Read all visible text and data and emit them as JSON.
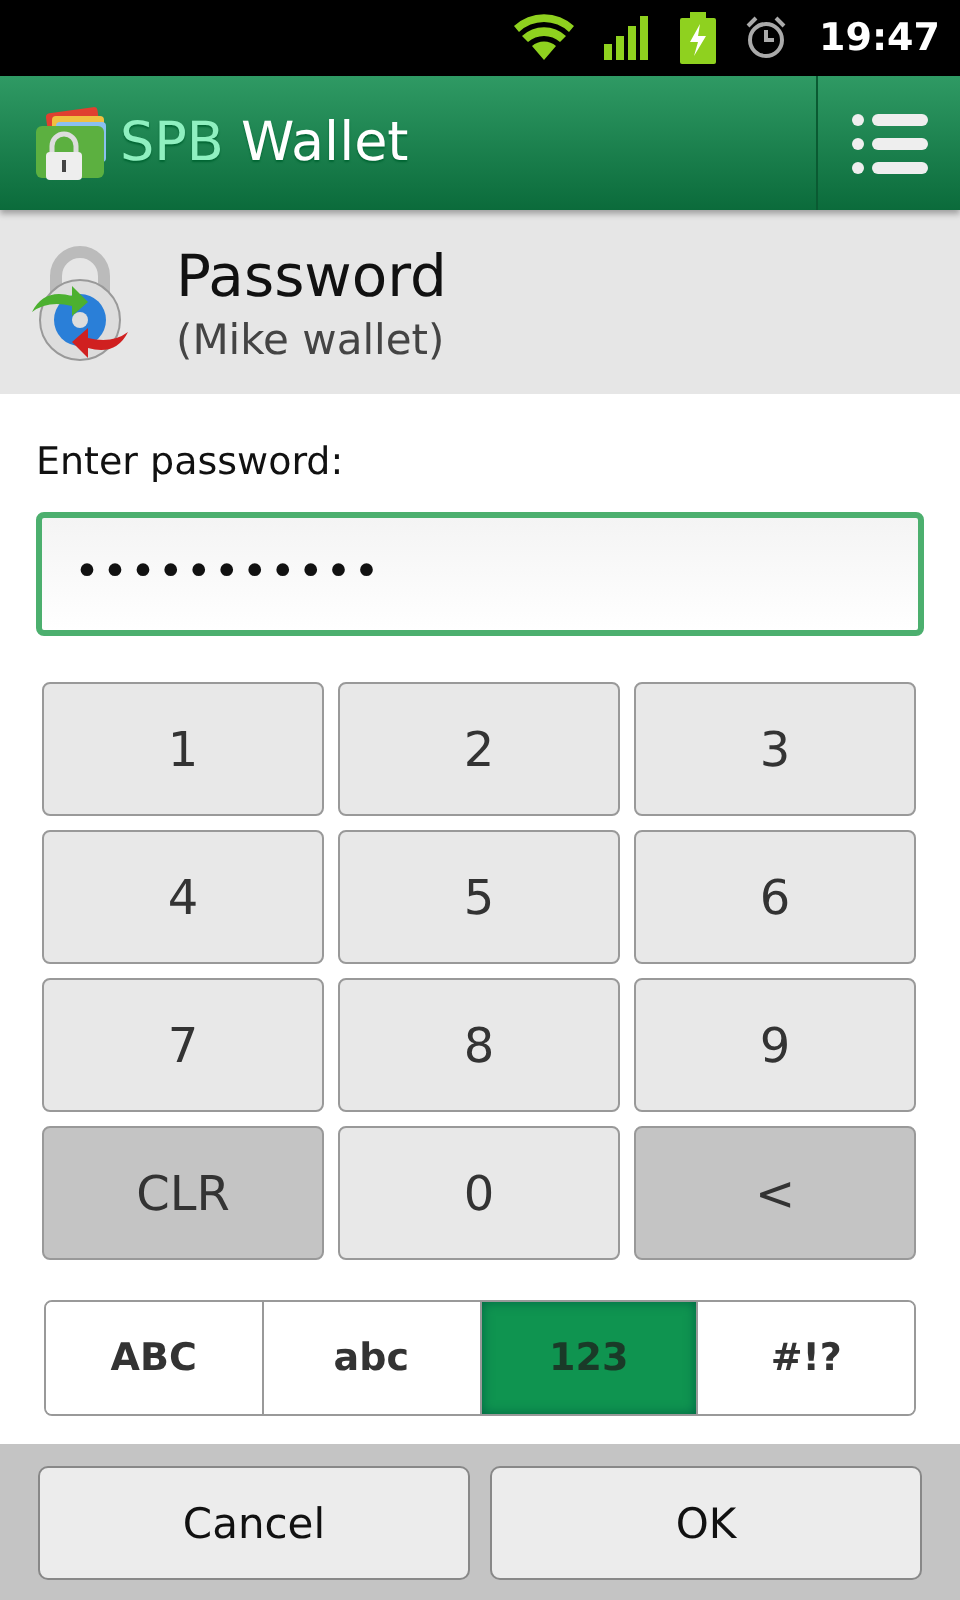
{
  "status_bar": {
    "time": "19:47"
  },
  "app_bar": {
    "brand": "SPB",
    "name": "Wallet"
  },
  "header": {
    "title": "Password",
    "subtitle": "(Mike wallet)"
  },
  "password": {
    "label": "Enter password:",
    "value": "•••••••••••",
    "focused": true
  },
  "keys": [
    {
      "label": "1",
      "kind": "digit"
    },
    {
      "label": "2",
      "kind": "digit"
    },
    {
      "label": "3",
      "kind": "digit"
    },
    {
      "label": "4",
      "kind": "digit"
    },
    {
      "label": "5",
      "kind": "digit"
    },
    {
      "label": "6",
      "kind": "digit"
    },
    {
      "label": "7",
      "kind": "digit"
    },
    {
      "label": "8",
      "kind": "digit"
    },
    {
      "label": "9",
      "kind": "digit"
    },
    {
      "label": "CLR",
      "kind": "function"
    },
    {
      "label": "0",
      "kind": "digit"
    },
    {
      "label": "<",
      "kind": "function"
    }
  ],
  "modes": [
    {
      "label": "ABC",
      "selected": false
    },
    {
      "label": "abc",
      "selected": false
    },
    {
      "label": "123",
      "selected": true
    },
    {
      "label": "#!?",
      "selected": false
    }
  ],
  "buttons": [
    "Cancel",
    "OK"
  ]
}
